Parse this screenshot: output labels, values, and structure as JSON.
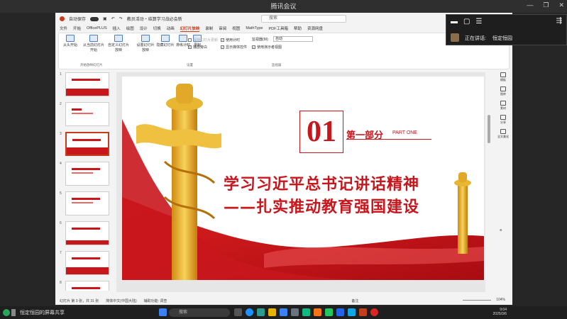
{
  "meeting": {
    "window_title": "腾讯会议",
    "share_label": "恒定恒园的屏幕共享",
    "speaker_label": "正在讲话:",
    "speaker_name": "恒定恒园"
  },
  "ppt": {
    "autosave_label": "自动保存",
    "file_name": "教员活动・结算学习战必会新",
    "search_placeholder": "搜索",
    "menu_tabs": [
      "文件",
      "开始",
      "OfficePLUS",
      "插入",
      "绘图",
      "设计",
      "切换",
      "动画",
      "幻灯片放映",
      "录制",
      "审阅",
      "视图",
      "MathType",
      "PDF工具箱",
      "帮助",
      "资源网盘"
    ],
    "active_tab": "幻灯片放映",
    "ribbon": {
      "btn_from_start": "从头开始",
      "btn_from_current": "从当前幻灯片开始",
      "btn_custom": "自定义幻灯片放映",
      "group_start": "开始放映幻灯片",
      "btn_setup": "设置幻灯片放映",
      "btn_hide": "隐藏幻灯片",
      "btn_rehearse": "排练计时",
      "btn_record": "录制",
      "chk_play_narration": "播放旁白",
      "chk_use_timing": "使用计时",
      "chk_show_media": "显示媒体控件",
      "chk_keep_updated": "保持幻灯片更新",
      "group_setup": "设置",
      "monitor_label": "监视器(M):",
      "monitor_value": "自动",
      "chk_presenter_view": "使用演示者视图",
      "group_monitors": "监视器"
    },
    "slide": {
      "number": "01",
      "part_cn": "第一部分",
      "part_en": "PART ONE",
      "title_line1": "学习习近平总书记讲话精神",
      "title_line2": "——扎实推动教育强国建设"
    },
    "thumbnail_numbers": [
      "1",
      "2",
      "3",
      "4",
      "5",
      "6",
      "7",
      "8"
    ],
    "right_pane": [
      "模板",
      "图库",
      "素材",
      "分享",
      "全文美化"
    ],
    "status": {
      "slide_info": "幻灯片 第 3 张，共 31 张",
      "language": "简体中文(中国大陆)",
      "accessibility": "辅助功能: 调查",
      "notes": "备注",
      "zoom": "104%"
    }
  },
  "taskbar": {
    "search_placeholder": "搜索",
    "time": "9:04",
    "date": "2025/3/6"
  },
  "colors": {
    "accent_red": "#c8161d",
    "ppt_brand": "#c43e1c"
  }
}
